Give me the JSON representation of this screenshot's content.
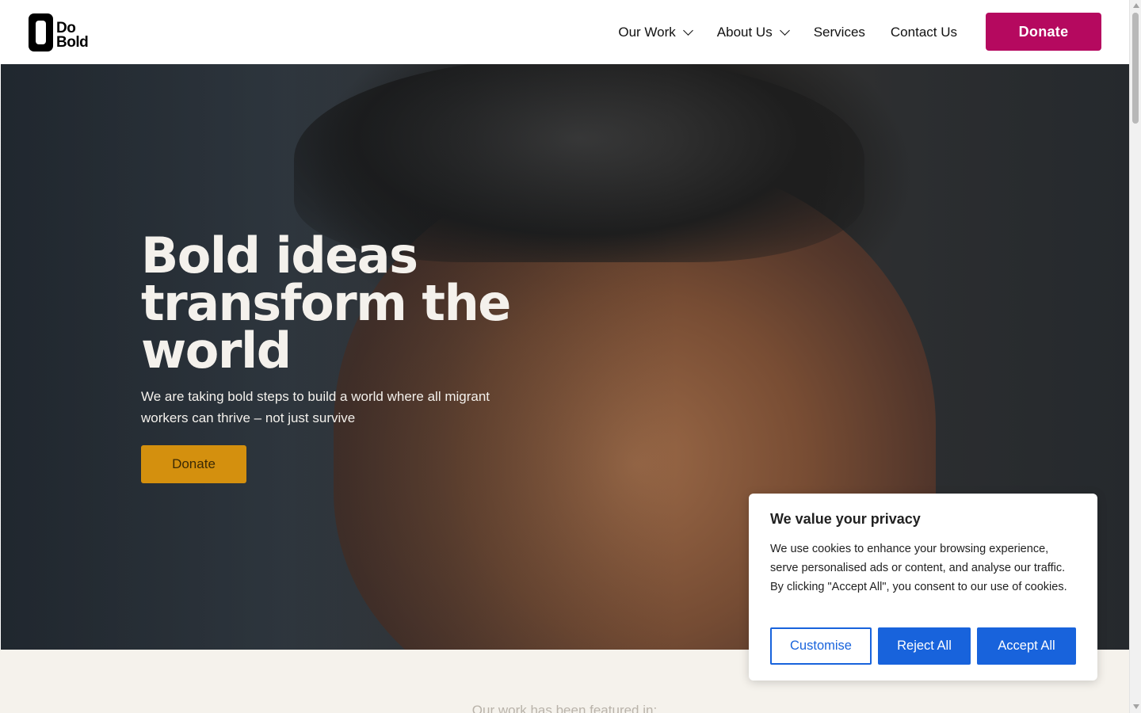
{
  "header": {
    "logo_line1": "Do",
    "logo_line2": "Bold",
    "nav": [
      {
        "label": "Our Work",
        "has_dropdown": true
      },
      {
        "label": "About Us",
        "has_dropdown": true
      },
      {
        "label": "Services",
        "has_dropdown": false
      },
      {
        "label": "Contact Us",
        "has_dropdown": false
      }
    ],
    "donate_label": "Donate"
  },
  "hero": {
    "title": "Bold ideas transform the world",
    "subtitle": "We are taking bold steps to build a world where all migrant workers can thrive – not just survive",
    "donate_label": "Donate"
  },
  "featured": {
    "label": "Our work has been featured in:"
  },
  "cookie_banner": {
    "title": "We value your privacy",
    "body": "We use cookies to enhance your browsing experience, serve personalised ads or content, and analyse our traffic. By clicking \"Accept All\", you consent to our use of cookies.",
    "customise_label": "Customise",
    "reject_label": "Reject All",
    "accept_label": "Accept All"
  },
  "colors": {
    "brand_donate": "#b5095f",
    "hero_donate": "#d4900e",
    "cookie_accent": "#1863dc",
    "featured_bg": "#f5f2ec"
  }
}
